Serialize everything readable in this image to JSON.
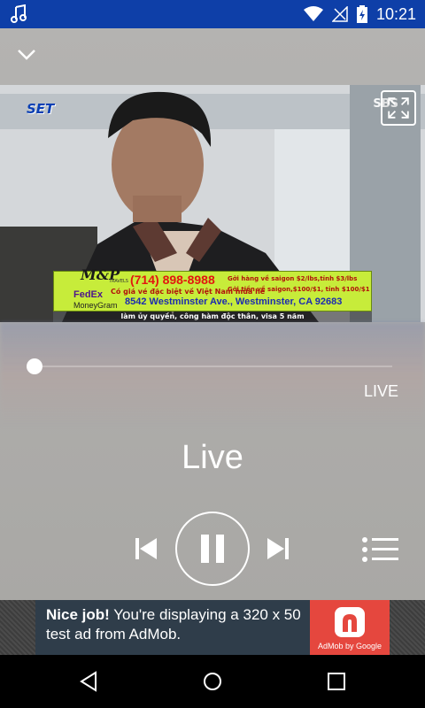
{
  "status_bar": {
    "time": "10:21",
    "icons": [
      "music-note-icon",
      "wifi-icon",
      "no-signal-icon",
      "battery-charging-icon"
    ]
  },
  "player": {
    "live_label": "LIVE",
    "title": "Live",
    "channel_logo_text": "SET",
    "channel_tag": "SBS",
    "tv_ad": {
      "brand": "M&P",
      "brand_sub": "TRAVELS",
      "phone": "(714) 898-8988",
      "right1": "Gởi hàng về saigon $2/lbs,tỉnh $3/lbs",
      "right2": "Gởi tiền về saigon,$100/$1, tỉnh $100/$1",
      "line1": "Có giá vé đặc biệt về Việt Nam mùa hè",
      "address": "8542 Westminster Ave., Westminster, CA 92683",
      "footer": "làm ủy quyền, công hàm độc thân, visa 5 năm",
      "fedex": "FedEx",
      "moneygram": "MoneyGram"
    },
    "controls": [
      "previous-icon",
      "pause-icon",
      "next-icon",
      "playlist-icon"
    ]
  },
  "admob": {
    "bold": "Nice job!",
    "text": " You're displaying a 320 x 50 test ad from AdMob.",
    "logo_caption": "AdMob by Google"
  },
  "colors": {
    "status_bar": "#0e3fa8",
    "admob_red": "#e5473e",
    "admob_panel": "#2f3d4a"
  }
}
